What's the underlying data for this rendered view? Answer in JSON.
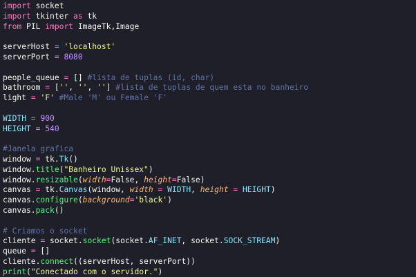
{
  "editor": {
    "language": "python",
    "theme_colors": {
      "background": "#1e1f29",
      "plain": "#f8f8f2",
      "keyword": "#ff79c6",
      "string": "#f1fa8c",
      "number": "#bd93f9",
      "comment": "#6272a4",
      "class": "#8be9fd",
      "function": "#50fa7b",
      "parameter": "#ffb86c"
    },
    "lines": [
      [
        [
          "kw",
          "import"
        ],
        [
          "pl",
          " socket"
        ]
      ],
      [
        [
          "kw",
          "import"
        ],
        [
          "pl",
          " tkinter "
        ],
        [
          "kw",
          "as"
        ],
        [
          "pl",
          " tk"
        ]
      ],
      [
        [
          "kw",
          "from"
        ],
        [
          "pl",
          " PIL "
        ],
        [
          "kw",
          "import"
        ],
        [
          "pl",
          " ImageTk,Image"
        ]
      ],
      [],
      [
        [
          "pl",
          "serverHost "
        ],
        [
          "kw",
          "="
        ],
        [
          "pl",
          " "
        ],
        [
          "str",
          "'localhost'"
        ]
      ],
      [
        [
          "pl",
          "serverPort "
        ],
        [
          "kw",
          "="
        ],
        [
          "pl",
          " "
        ],
        [
          "num",
          "8080"
        ]
      ],
      [],
      [
        [
          "pl",
          "people_queue "
        ],
        [
          "kw",
          "="
        ],
        [
          "pl",
          " [] "
        ],
        [
          "cmt",
          "#lista de tuplas (id, char)"
        ]
      ],
      [
        [
          "pl",
          "bathroom "
        ],
        [
          "kw",
          "="
        ],
        [
          "pl",
          " ["
        ],
        [
          "str",
          "''"
        ],
        [
          "pl",
          ", "
        ],
        [
          "str",
          "''"
        ],
        [
          "pl",
          ", "
        ],
        [
          "str",
          "''"
        ],
        [
          "pl",
          "] "
        ],
        [
          "cmt",
          "#lista de tuplas de quem esta no banheiro"
        ]
      ],
      [
        [
          "pl",
          "light "
        ],
        [
          "kw",
          "="
        ],
        [
          "pl",
          " "
        ],
        [
          "str",
          "'F'"
        ],
        [
          "pl",
          " "
        ],
        [
          "cmt",
          "#Male 'M' ou Female 'F'"
        ]
      ],
      [],
      [
        [
          "const",
          "WIDTH"
        ],
        [
          "pl",
          " "
        ],
        [
          "kw",
          "="
        ],
        [
          "pl",
          " "
        ],
        [
          "num",
          "900"
        ]
      ],
      [
        [
          "const",
          "HEIGHT"
        ],
        [
          "pl",
          " "
        ],
        [
          "kw",
          "="
        ],
        [
          "pl",
          " "
        ],
        [
          "num",
          "540"
        ]
      ],
      [],
      [
        [
          "cmt",
          "#Janela grafica"
        ]
      ],
      [
        [
          "pl",
          "window "
        ],
        [
          "kw",
          "="
        ],
        [
          "pl",
          " tk."
        ],
        [
          "cls",
          "Tk"
        ],
        [
          "pl",
          "()"
        ]
      ],
      [
        [
          "pl",
          "window."
        ],
        [
          "fn",
          "title"
        ],
        [
          "pl",
          "("
        ],
        [
          "str",
          "\"Banheiro Unissex\""
        ],
        [
          "pl",
          ")"
        ]
      ],
      [
        [
          "pl",
          "window."
        ],
        [
          "fn",
          "resizable"
        ],
        [
          "pl",
          "("
        ],
        [
          "par",
          "width"
        ],
        [
          "kw",
          "="
        ],
        [
          "pl",
          "False, "
        ],
        [
          "par",
          "height"
        ],
        [
          "kw",
          "="
        ],
        [
          "pl",
          "False)"
        ]
      ],
      [
        [
          "pl",
          "canvas "
        ],
        [
          "kw",
          "="
        ],
        [
          "pl",
          " tk."
        ],
        [
          "cls",
          "Canvas"
        ],
        [
          "pl",
          "(window, "
        ],
        [
          "par",
          "width"
        ],
        [
          "pl",
          " "
        ],
        [
          "kw",
          "="
        ],
        [
          "pl",
          " "
        ],
        [
          "const",
          "WIDTH"
        ],
        [
          "pl",
          ", "
        ],
        [
          "par",
          "height"
        ],
        [
          "pl",
          " "
        ],
        [
          "kw",
          "="
        ],
        [
          "pl",
          " "
        ],
        [
          "const",
          "HEIGHT"
        ],
        [
          "pl",
          ")"
        ]
      ],
      [
        [
          "pl",
          "canvas."
        ],
        [
          "fn",
          "configure"
        ],
        [
          "pl",
          "("
        ],
        [
          "par",
          "background"
        ],
        [
          "kw",
          "="
        ],
        [
          "str",
          "'black'"
        ],
        [
          "pl",
          ")"
        ]
      ],
      [
        [
          "pl",
          "canvas."
        ],
        [
          "fn",
          "pack"
        ],
        [
          "pl",
          "()"
        ]
      ],
      [],
      [
        [
          "cmt",
          "# Criamos o socket"
        ]
      ],
      [
        [
          "pl",
          "cliente "
        ],
        [
          "kw",
          "="
        ],
        [
          "pl",
          " socket."
        ],
        [
          "fn",
          "socket"
        ],
        [
          "pl",
          "(socket."
        ],
        [
          "const",
          "AF_INET"
        ],
        [
          "pl",
          ", socket."
        ],
        [
          "const",
          "SOCK_STREAM"
        ],
        [
          "pl",
          ")"
        ]
      ],
      [
        [
          "pl",
          "queue "
        ],
        [
          "kw",
          "="
        ],
        [
          "pl",
          " []"
        ]
      ],
      [
        [
          "pl",
          "cliente."
        ],
        [
          "fn",
          "connect"
        ],
        [
          "pl",
          "((serverHost, serverPort))"
        ]
      ],
      [
        [
          "fn",
          "print"
        ],
        [
          "pl",
          "("
        ],
        [
          "str",
          "\"Conectado com o servidor.\""
        ],
        [
          "pl",
          ")"
        ]
      ]
    ]
  }
}
